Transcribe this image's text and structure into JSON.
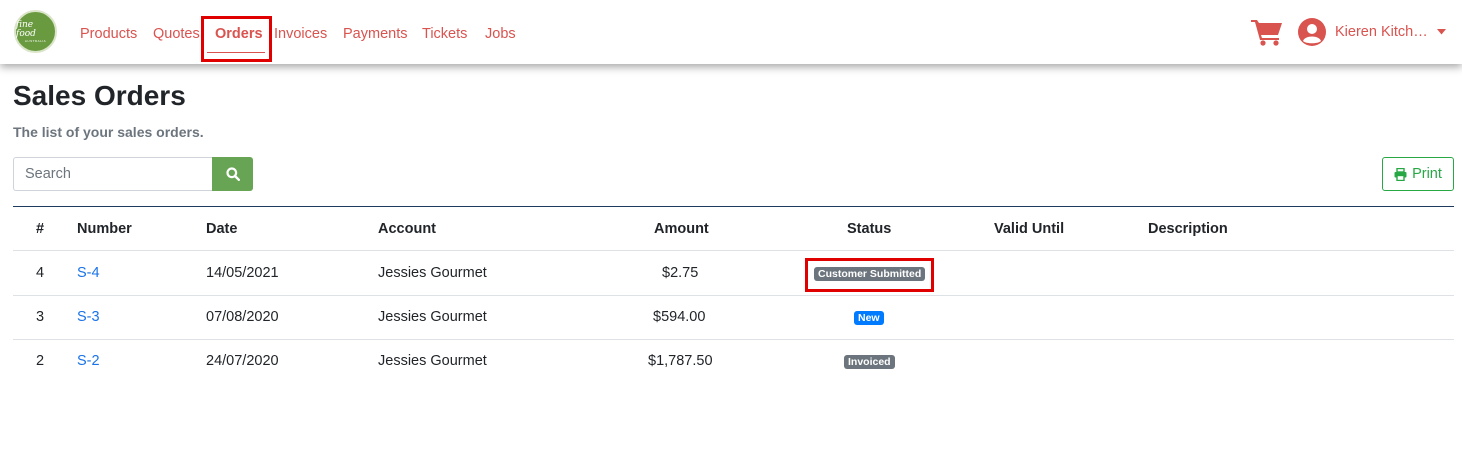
{
  "brand": {
    "logo_line1": "fine food",
    "logo_line2": "AUSTRALIA"
  },
  "nav": {
    "items": [
      "Products",
      "Quotes",
      "Orders",
      "Invoices",
      "Payments",
      "Tickets",
      "Jobs"
    ],
    "active": "Orders",
    "accent_color": "#d9534f"
  },
  "user": {
    "name": "Kieren Kitche…"
  },
  "page": {
    "title": "Sales Orders",
    "subtitle": "The list of your sales orders."
  },
  "search": {
    "placeholder": "Search"
  },
  "print_label": "Print",
  "table": {
    "headers": [
      "#",
      "Number",
      "Date",
      "Account",
      "Amount",
      "Status",
      "Valid Until",
      "Description"
    ],
    "rows": [
      {
        "index": "4",
        "number": "S-4",
        "date": "14/05/2021",
        "account": "Jessies Gourmet",
        "amount": "$2.75",
        "status": "Customer Submitted",
        "status_color": "#6c757d",
        "valid_until": "",
        "description": ""
      },
      {
        "index": "3",
        "number": "S-3",
        "date": "07/08/2020",
        "account": "Jessies Gourmet",
        "amount": "$594.00",
        "status": "New",
        "status_color": "#007bff",
        "valid_until": "",
        "description": ""
      },
      {
        "index": "2",
        "number": "S-2",
        "date": "24/07/2020",
        "account": "Jessies Gourmet",
        "amount": "$1,787.50",
        "status": "Invoiced",
        "status_color": "#6c757d",
        "valid_until": "",
        "description": ""
      }
    ]
  },
  "highlight_color": "#e00000"
}
